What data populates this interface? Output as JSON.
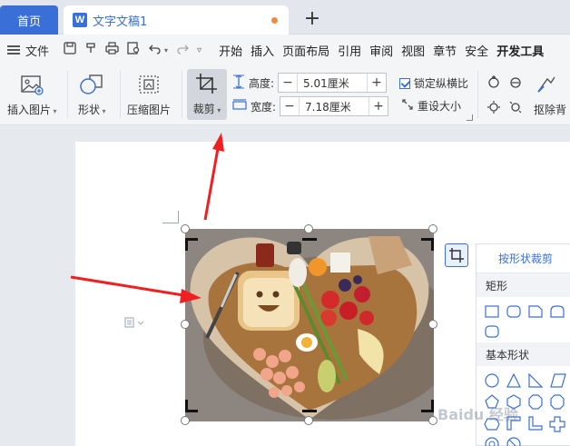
{
  "tabs": {
    "home": "首页",
    "doc_title": "文字文稿1",
    "doc_icon": "W"
  },
  "menu": {
    "file": "文件",
    "items": [
      "开始",
      "插入",
      "页面布局",
      "引用",
      "审阅",
      "视图",
      "章节",
      "安全",
      "开发工具"
    ]
  },
  "ribbon": {
    "insert_picture": "插入图片",
    "shape": "形状",
    "compress": "压缩图片",
    "crop": "裁剪",
    "height_label": "高度:",
    "height_value": "5.01厘米",
    "width_label": "宽度:",
    "width_value": "7.18厘米",
    "lock_ratio": "锁定纵横比",
    "reset_size": "重设大小",
    "remove_bg": "抠除背"
  },
  "shape_panel": {
    "title": "按形状裁剪",
    "section_rect": "矩形",
    "section_basic": "基本形状"
  },
  "watermark": "Baidu 经验",
  "colors": {
    "accent": "#3a6fd8",
    "arrow": "#f02020",
    "unsaved": "#f08a3c"
  }
}
